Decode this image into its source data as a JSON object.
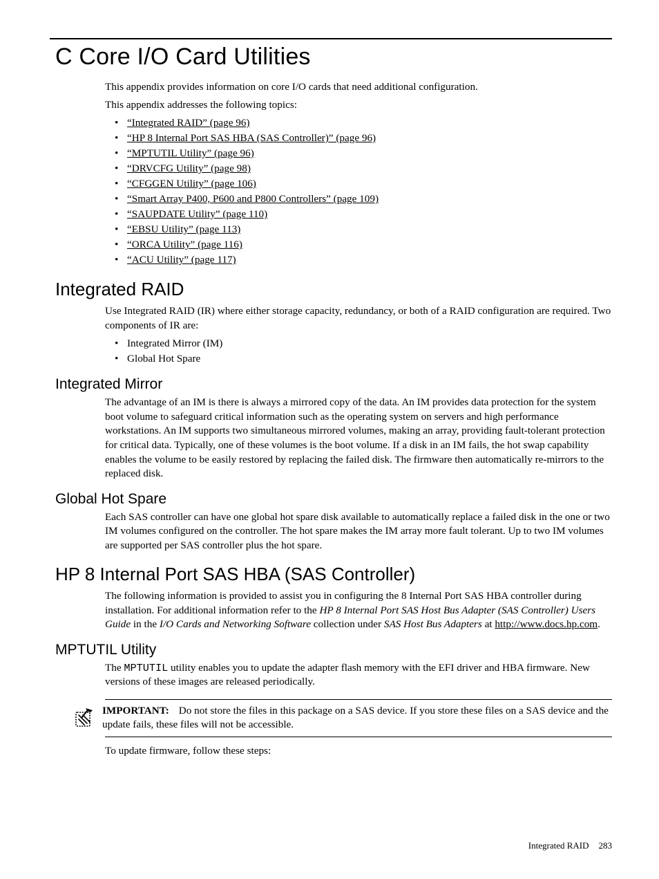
{
  "title": "C Core I/O Card Utilities",
  "intro": {
    "p1": "This appendix provides information on core I/O cards that need additional configuration.",
    "p2": "This appendix addresses the following topics:"
  },
  "toc": [
    "“Integrated RAID” (page 96)",
    "“HP 8 Internal Port SAS HBA (SAS Controller)” (page 96)",
    "“MPTUTIL Utility” (page 96)",
    "“DRVCFG Utility” (page 98)",
    "“CFGGEN Utility” (page 106)",
    "“Smart Array P400, P600 and P800 Controllers” (page 109)",
    "“SAUPDATE Utility” (page 110)",
    "“EBSU Utility” (page 113)",
    "“ORCA Utility” (page 116)",
    "“ACU Utility” (page 117)"
  ],
  "sections": {
    "integrated_raid": {
      "heading": "Integrated RAID",
      "p1": "Use Integrated RAID (IR) where either storage capacity, redundancy, or both of a RAID configuration are required. Two components of IR are:",
      "items": [
        "Integrated Mirror (IM)",
        "Global Hot Spare"
      ]
    },
    "integrated_mirror": {
      "heading": "Integrated Mirror",
      "p1": "The advantage of an IM is there is always a mirrored copy of the data. An IM provides data protection for the system boot volume to safeguard critical information such as the operating system on servers and high performance workstations. An IM supports two simultaneous mirrored volumes, making an array, providing fault-tolerant protection for critical data. Typically, one of these volumes is the boot volume. If a disk in an IM fails, the hot swap capability enables the volume to be easily restored by replacing the failed disk. The firmware then automatically re-mirrors to the replaced disk."
    },
    "global_hot_spare": {
      "heading": "Global Hot Spare",
      "p1": "Each SAS controller can have one global hot spare disk available to automatically replace a failed disk in the one or two IM volumes configured on the controller. The hot spare makes the IM array more fault tolerant. Up to two IM volumes are supported per SAS controller plus the hot spare."
    },
    "hp8": {
      "heading": "HP 8 Internal Port SAS HBA (SAS Controller)",
      "p1a": "The following information is provided to assist you in configuring the 8 Internal Port SAS HBA controller during installation. For additional information refer to the ",
      "ital1": "HP 8 Internal Port SAS Host Bus Adapter (SAS Controller) Users Guide",
      "p1b": " in the ",
      "ital2": "I/O Cards and Networking Software",
      "p1c": " collection under ",
      "ital3": "SAS Host Bus Adapters",
      "p1d": " at ",
      "link": "http://www.docs.hp.com",
      "p1e": "."
    },
    "mptutil": {
      "heading": "MPTUTIL Utility",
      "p1a": "The ",
      "mono": "MPTUTIL",
      "p1b": " utility enables you to update the adapter flash memory with the EFI driver and HBA firmware. New versions of these images are released periodically.",
      "important": {
        "label": "IMPORTANT:",
        "text": "Do not store the files in this package on a SAS device. If you store these files on a SAS device and the update fails, these files will not be accessible."
      },
      "p2": "To update firmware, follow these steps:"
    }
  },
  "footer": {
    "section": "Integrated RAID",
    "page": "283"
  }
}
